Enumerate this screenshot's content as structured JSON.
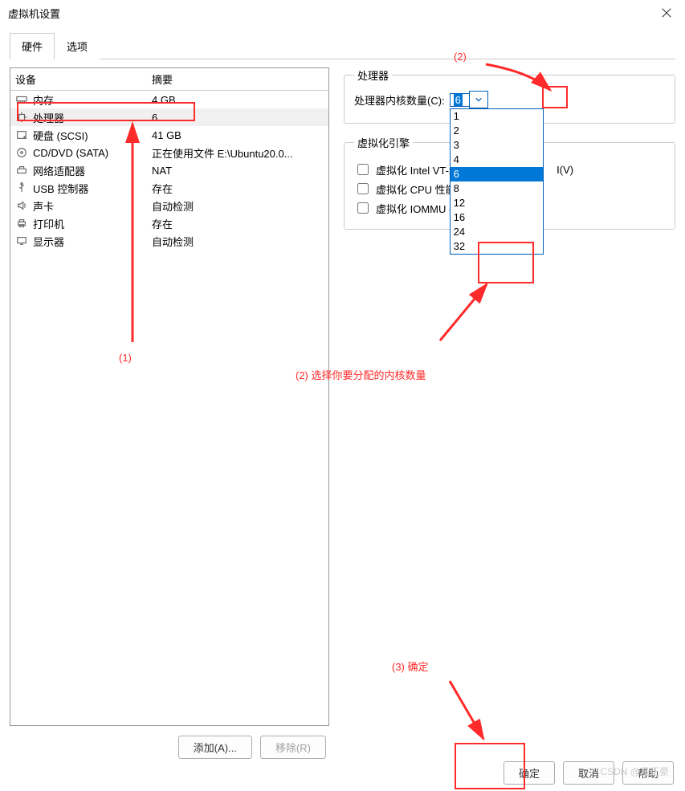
{
  "window": {
    "title": "虚拟机设置"
  },
  "tabs": {
    "hardware": "硬件",
    "options": "选项"
  },
  "device_list": {
    "col_device": "设备",
    "col_summary": "摘要",
    "rows": [
      {
        "name": "内存",
        "summary": "4 GB",
        "icon": "memory-icon"
      },
      {
        "name": "处理器",
        "summary": "6",
        "icon": "cpu-icon",
        "selected": true
      },
      {
        "name": "硬盘 (SCSI)",
        "summary": "41 GB",
        "icon": "disk-icon"
      },
      {
        "name": "CD/DVD (SATA)",
        "summary": "正在使用文件 E:\\Ubuntu20.0...",
        "icon": "cd-icon"
      },
      {
        "name": "网络适配器",
        "summary": "NAT",
        "icon": "network-icon"
      },
      {
        "name": "USB 控制器",
        "summary": "存在",
        "icon": "usb-icon"
      },
      {
        "name": "声卡",
        "summary": "自动检测",
        "icon": "sound-icon"
      },
      {
        "name": "打印机",
        "summary": "存在",
        "icon": "printer-icon"
      },
      {
        "name": "显示器",
        "summary": "自动检测",
        "icon": "display-icon"
      }
    ]
  },
  "left_buttons": {
    "add": "添加(A)...",
    "remove": "移除(R)"
  },
  "processor_group": {
    "legend": "处理器",
    "cores_label": "处理器内核数量(C):",
    "cores_value": "6"
  },
  "cores_options": [
    "1",
    "2",
    "4",
    "6",
    "8",
    "12",
    "16",
    "24",
    "32"
  ],
  "alt_options": [
    "1",
    "2",
    "3",
    "4",
    "6",
    "8",
    "12",
    "16",
    "24",
    "32"
  ],
  "virt_group": {
    "legend": "虚拟化引擎",
    "vtx": "虚拟化 Intel VT-x/",
    "vtx_tail": "I(V)",
    "cpu": "虚拟化 CPU 性能计",
    "iommu": "虚拟化 IOMMU (I"
  },
  "bottom_buttons": {
    "ok": "确定",
    "cancel": "取消",
    "help": "帮助"
  },
  "watermark": "CSDN @吕正豪",
  "annotations": {
    "a1": "(1)",
    "a2_top": "(2)",
    "a2_text": "(2)  选择你要分配的内核数量",
    "a3_text": "(3)  确定"
  }
}
